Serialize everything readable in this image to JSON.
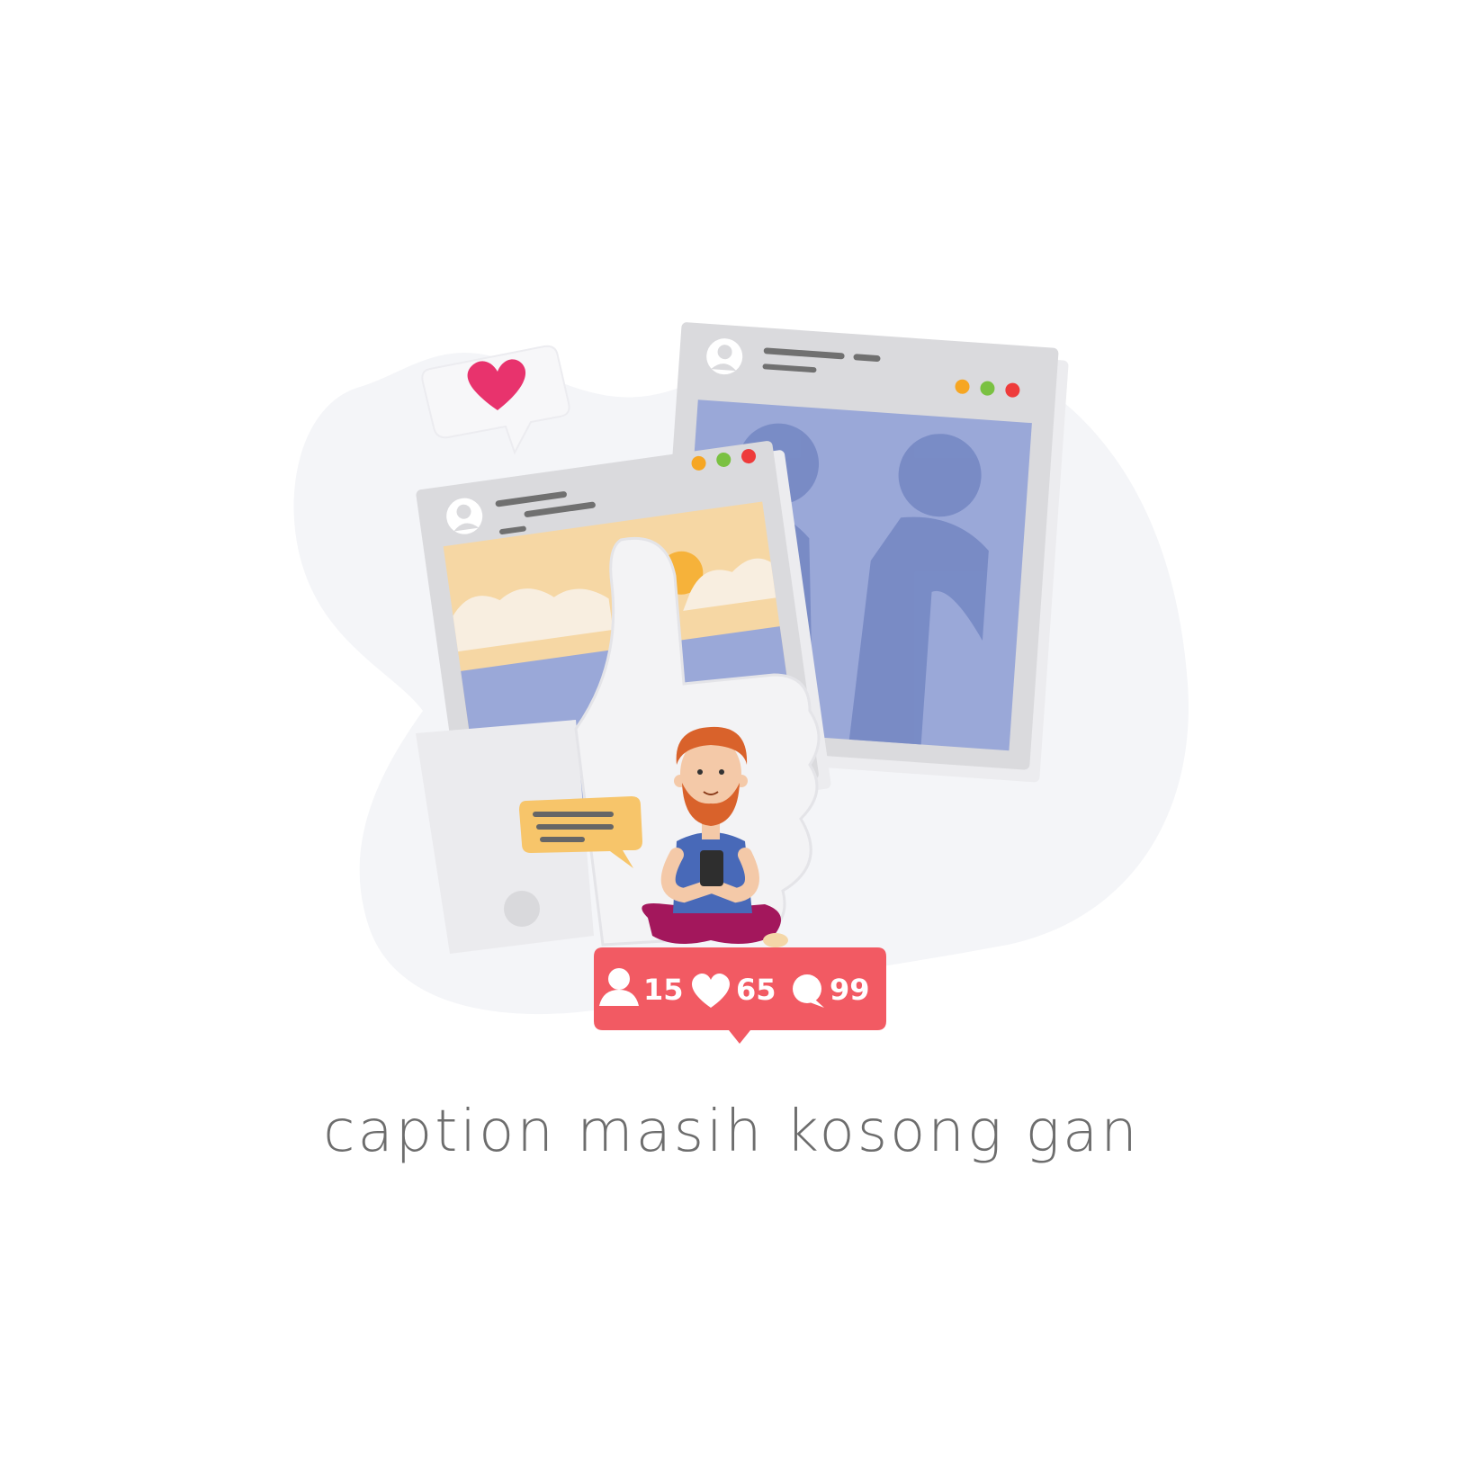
{
  "caption": "caption masih kosong gan",
  "stats": {
    "followers": "15",
    "likes": "65",
    "comments": "99"
  },
  "icons": {
    "followers": "user-icon",
    "likes": "heart-icon",
    "comments": "comment-icon",
    "window_controls": [
      "minimize-icon",
      "maximize-icon",
      "close-icon"
    ]
  },
  "colors": {
    "notification_badge": "#f25a63",
    "heart": "#e8336d",
    "chat_bubble": "#f7c56a",
    "window_minimize": "#f6a623",
    "window_maximize": "#7ac142",
    "window_close": "#ee3b3b",
    "shirt": "#4869b8",
    "pants": "#a3175c",
    "beard": "#d9622b"
  }
}
